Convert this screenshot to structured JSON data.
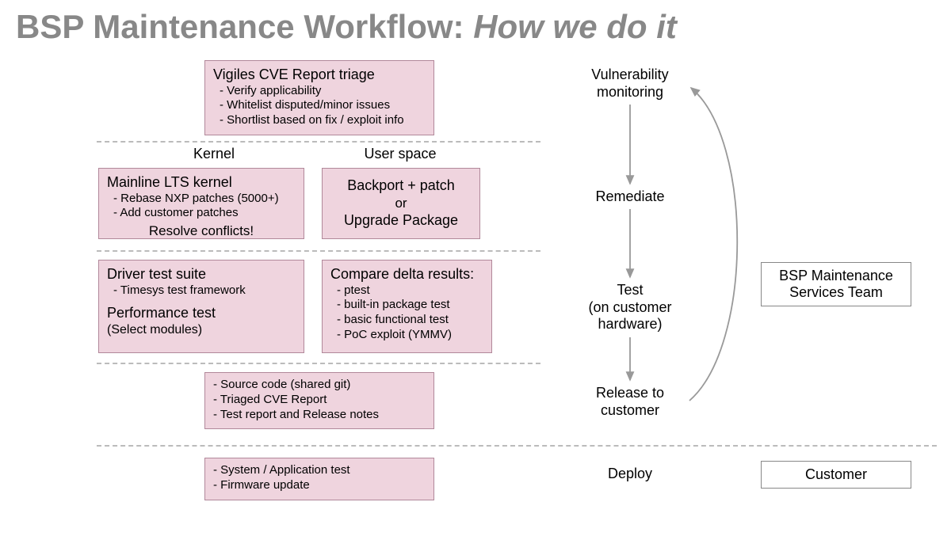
{
  "title_prefix": "BSP Maintenance Workflow: ",
  "title_italic": "How we do it",
  "triage": {
    "title": "Vigiles CVE Report triage",
    "b1": "- Verify applicability",
    "b2": "- Whitelist disputed/minor issues",
    "b3": "- Shortlist based on fix / exploit info"
  },
  "col_labels": {
    "kernel": "Kernel",
    "user": "User space"
  },
  "kernel_rem": {
    "title": "Mainline LTS kernel",
    "b1": "- Rebase NXP patches (5000+)",
    "b2": "- Add customer patches",
    "resolve": "Resolve conflicts!"
  },
  "user_rem": {
    "l1": "Backport + patch",
    "l2": "or",
    "l3": "Upgrade Package"
  },
  "kernel_test": {
    "t1": "Driver test suite",
    "b1": "- Timesys test framework",
    "t2": "Performance test",
    "b2": "(Select modules)"
  },
  "user_test": {
    "t1": "Compare delta results:",
    "b1": "- ptest",
    "b2": "- built-in package test",
    "b3": "- basic functional test",
    "b4": "- PoC exploit (YMMV)"
  },
  "release": {
    "b1": "- Source code (shared git)",
    "b2": "- Triaged CVE Report",
    "b3": "- Test report and Release notes"
  },
  "deploy_box": {
    "b1": "- System / Application test",
    "b2": "- Firmware update"
  },
  "flow": {
    "vuln": "Vulnerability monitoring",
    "rem": "Remediate",
    "test": "Test",
    "test2": "(on customer hardware)",
    "rel": "Release to customer",
    "dep": "Deploy"
  },
  "team": {
    "l1": "BSP Maintenance",
    "l2": "Services Team"
  },
  "customer": "Customer"
}
